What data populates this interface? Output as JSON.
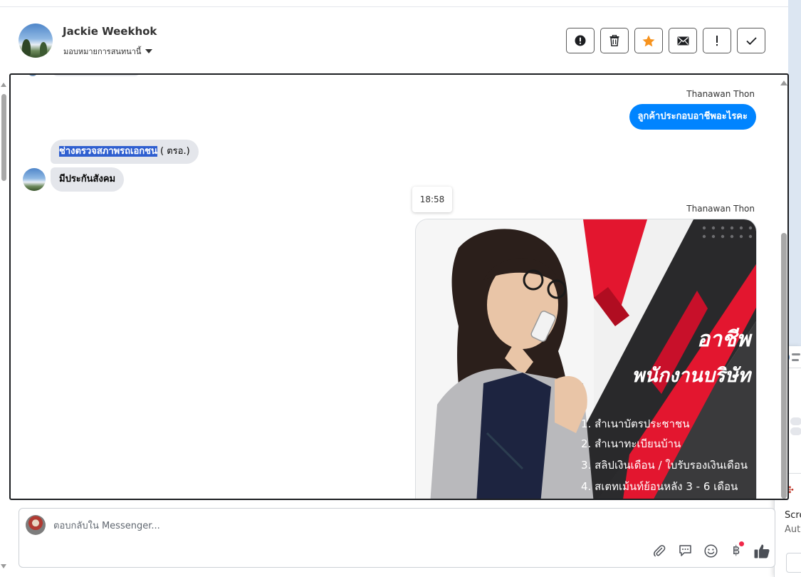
{
  "header": {
    "contact_name": "Jackie Weekhok",
    "assign_label": "มอบหมายการสนทนานี้"
  },
  "actions": [
    {
      "name": "spam-button",
      "icon": "alert-circle-icon"
    },
    {
      "name": "delete-button",
      "icon": "trash-icon"
    },
    {
      "name": "star-button",
      "icon": "star-icon"
    },
    {
      "name": "mark-unread-button",
      "icon": "envelope-icon"
    },
    {
      "name": "follow-up-button",
      "icon": "exclamation-icon"
    },
    {
      "name": "done-button",
      "icon": "check-icon"
    }
  ],
  "colors": {
    "outgoing_bubble": "#0084ff",
    "incoming_bubble": "#e4e6eb",
    "selection_highlight": "#2f5fd0",
    "star": "#f7931e",
    "notification_dot": "#f02849"
  },
  "messages": {
    "sender_1": "Thanawan Thon",
    "outgoing_1": "ลูกค้าประกอบอาชีพอะไรคะ",
    "incoming_1_selected": "ช่างตรวจสภาพรถเอกชน",
    "incoming_1_rest": " ( ตรอ.)",
    "incoming_2": "มีประกันสังคม",
    "timestamp": "18:58",
    "sender_2": "Thanawan Thon"
  },
  "image_card": {
    "title_line_1": "อาชีพ",
    "title_line_2": "พนักงานบริษัท",
    "items": [
      "1. สำเนาบัตรประชาชน",
      "2. สำเนาทะเบียนบ้าน",
      "3. สลิปเงินเดือน / ใบรับรองเงินเดือน",
      "4. สเตทเม้นท์ย้อนหลัง 3 - 6 เดือน"
    ]
  },
  "composer": {
    "placeholder": "ตอบกลับใน Messenger...",
    "tools": [
      "paperclip-icon",
      "saved-reply-icon",
      "emoji-icon",
      "baht-icon",
      "thumbs-up-icon"
    ],
    "baht_symbol": "฿"
  },
  "side_panel": {
    "title": "Scre",
    "subtitle": "Auto"
  }
}
